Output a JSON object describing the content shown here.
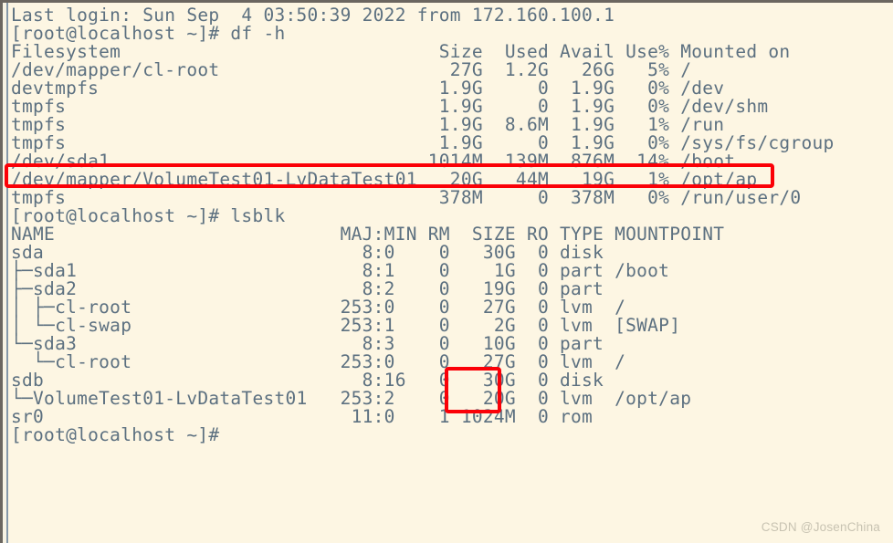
{
  "terminal": {
    "prompt": "[root@localhost ~]#",
    "login_banner": "Last login: Sun Sep  4 03:50:39 2022 from 172.160.100.1",
    "commands": {
      "df": "df -h",
      "lsblk": "lsblk"
    },
    "lines": [
      "Last login: Sun Sep  4 03:50:39 2022 from 172.160.100.1",
      "[root@localhost ~]# df -h",
      "Filesystem                             Size  Used Avail Use% Mounted on",
      "/dev/mapper/cl-root                     27G  1.2G   26G   5% /",
      "devtmpfs                               1.9G     0  1.9G   0% /dev",
      "tmpfs                                  1.9G     0  1.9G   0% /dev/shm",
      "tmpfs                                  1.9G  8.6M  1.9G   1% /run",
      "tmpfs                                  1.9G     0  1.9G   0% /sys/fs/cgroup",
      "/dev/sda1                             1014M  139M  876M  14% /boot",
      "/dev/mapper/VolumeTest01-LvDataTest01   20G   44M   19G   1% /opt/ap",
      "tmpfs                                  378M     0  378M   0% /run/user/0",
      "[root@localhost ~]# lsblk",
      "NAME                          MAJ:MIN RM  SIZE RO TYPE MOUNTPOINT",
      "sda                             8:0    0   30G  0 disk ",
      "├─sda1                          8:1    0    1G  0 part /boot",
      "├─sda2                          8:2    0   19G  0 part ",
      "│ ├─cl-root                   253:0    0   27G  0 lvm  /",
      "│ └─cl-swap                   253:1    0    2G  0 lvm  [SWAP]",
      "└─sda3                          8:3    0   10G  0 part ",
      "  └─cl-root                   253:0    0   27G  0 lvm  /",
      "sdb                             8:16   0   30G  0 disk ",
      "└─VolumeTest01-LvDataTest01   253:2    0   20G  0 lvm  /opt/ap",
      "sr0                            11:0    1 1024M  0 rom  ",
      "[root@localhost ~]#"
    ],
    "df_table": {
      "headers": [
        "Filesystem",
        "Size",
        "Used",
        "Avail",
        "Use%",
        "Mounted on"
      ],
      "rows": [
        [
          "/dev/mapper/cl-root",
          "27G",
          "1.2G",
          "26G",
          "5%",
          "/"
        ],
        [
          "devtmpfs",
          "1.9G",
          "0",
          "1.9G",
          "0%",
          "/dev"
        ],
        [
          "tmpfs",
          "1.9G",
          "0",
          "1.9G",
          "0%",
          "/dev/shm"
        ],
        [
          "tmpfs",
          "1.9G",
          "8.6M",
          "1.9G",
          "1%",
          "/run"
        ],
        [
          "tmpfs",
          "1.9G",
          "0",
          "1.9G",
          "0%",
          "/sys/fs/cgroup"
        ],
        [
          "/dev/sda1",
          "1014M",
          "139M",
          "876M",
          "14%",
          "/boot"
        ],
        [
          "/dev/mapper/VolumeTest01-LvDataTest01",
          "20G",
          "44M",
          "19G",
          "1%",
          "/opt/ap"
        ],
        [
          "tmpfs",
          "378M",
          "0",
          "378M",
          "0%",
          "/run/user/0"
        ]
      ]
    },
    "lsblk_table": {
      "headers": [
        "NAME",
        "MAJ:MIN",
        "RM",
        "SIZE",
        "RO",
        "TYPE",
        "MOUNTPOINT"
      ],
      "rows": [
        [
          "sda",
          "8:0",
          "0",
          "30G",
          "0",
          "disk",
          ""
        ],
        [
          "├─sda1",
          "8:1",
          "0",
          "1G",
          "0",
          "part",
          "/boot"
        ],
        [
          "├─sda2",
          "8:2",
          "0",
          "19G",
          "0",
          "part",
          ""
        ],
        [
          "│ ├─cl-root",
          "253:0",
          "0",
          "27G",
          "0",
          "lvm",
          "/"
        ],
        [
          "│ └─cl-swap",
          "253:1",
          "0",
          "2G",
          "0",
          "lvm",
          "[SWAP]"
        ],
        [
          "└─sda3",
          "8:3",
          "0",
          "10G",
          "0",
          "part",
          ""
        ],
        [
          "  └─cl-root",
          "253:0",
          "0",
          "27G",
          "0",
          "lvm",
          "/"
        ],
        [
          "sdb",
          "8:16",
          "0",
          "30G",
          "0",
          "disk",
          ""
        ],
        [
          "└─VolumeTest01-LvDataTest01",
          "253:2",
          "0",
          "20G",
          "0",
          "lvm",
          "/opt/ap"
        ],
        [
          "sr0",
          "11:0",
          "1",
          "1024M",
          "0",
          "rom",
          ""
        ]
      ]
    }
  },
  "annotations": {
    "color": "#fb0007",
    "box_1_label": "/dev/mapper/VolumeTest01-LvDataTest01 row",
    "box_2_label": "lsblk sdb 30G / 20G sizes"
  },
  "watermark": {
    "text": "CSDN @JosenChina",
    "color": "#c8c3b2"
  }
}
